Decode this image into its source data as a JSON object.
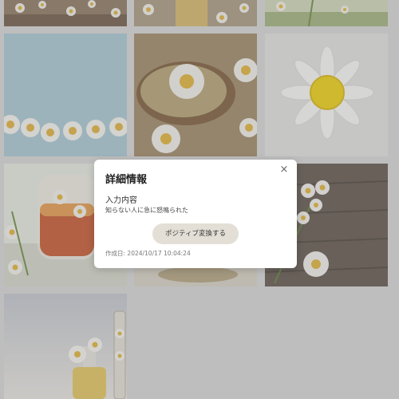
{
  "dialog": {
    "title": "詳細情報",
    "close_symbol": "×",
    "input_label": "入力内容",
    "input_text": "知らない人に急に怒鳴られた",
    "convert_button": "ポジティブ変換する",
    "created_label": "作成日:",
    "created_at": "2024/10/17 10:04:24"
  },
  "images": [
    {
      "name": "chamomile-flowers-on-wood",
      "icon": "chamomile-photo"
    },
    {
      "name": "chamomile-jar",
      "icon": "chamomile-photo"
    },
    {
      "name": "chamomile-field",
      "icon": "chamomile-photo"
    },
    {
      "name": "daisy-chain-on-blue",
      "icon": "chamomile-photo"
    },
    {
      "name": "dried-chamomile-spoon",
      "icon": "chamomile-photo"
    },
    {
      "name": "single-daisy-white",
      "icon": "chamomile-photo"
    },
    {
      "name": "chamomile-tea-cup",
      "icon": "chamomile-photo"
    },
    {
      "name": "tea-herbs-plate",
      "icon": "chamomile-photo"
    },
    {
      "name": "chamomile-on-dark-wood",
      "icon": "chamomile-photo"
    },
    {
      "name": "chamomile-oil-bottles",
      "icon": "chamomile-photo"
    }
  ],
  "colors": {
    "overlay": "#808080",
    "dialog_bg": "#ffffff",
    "button_bg": "#e3dfd6"
  }
}
